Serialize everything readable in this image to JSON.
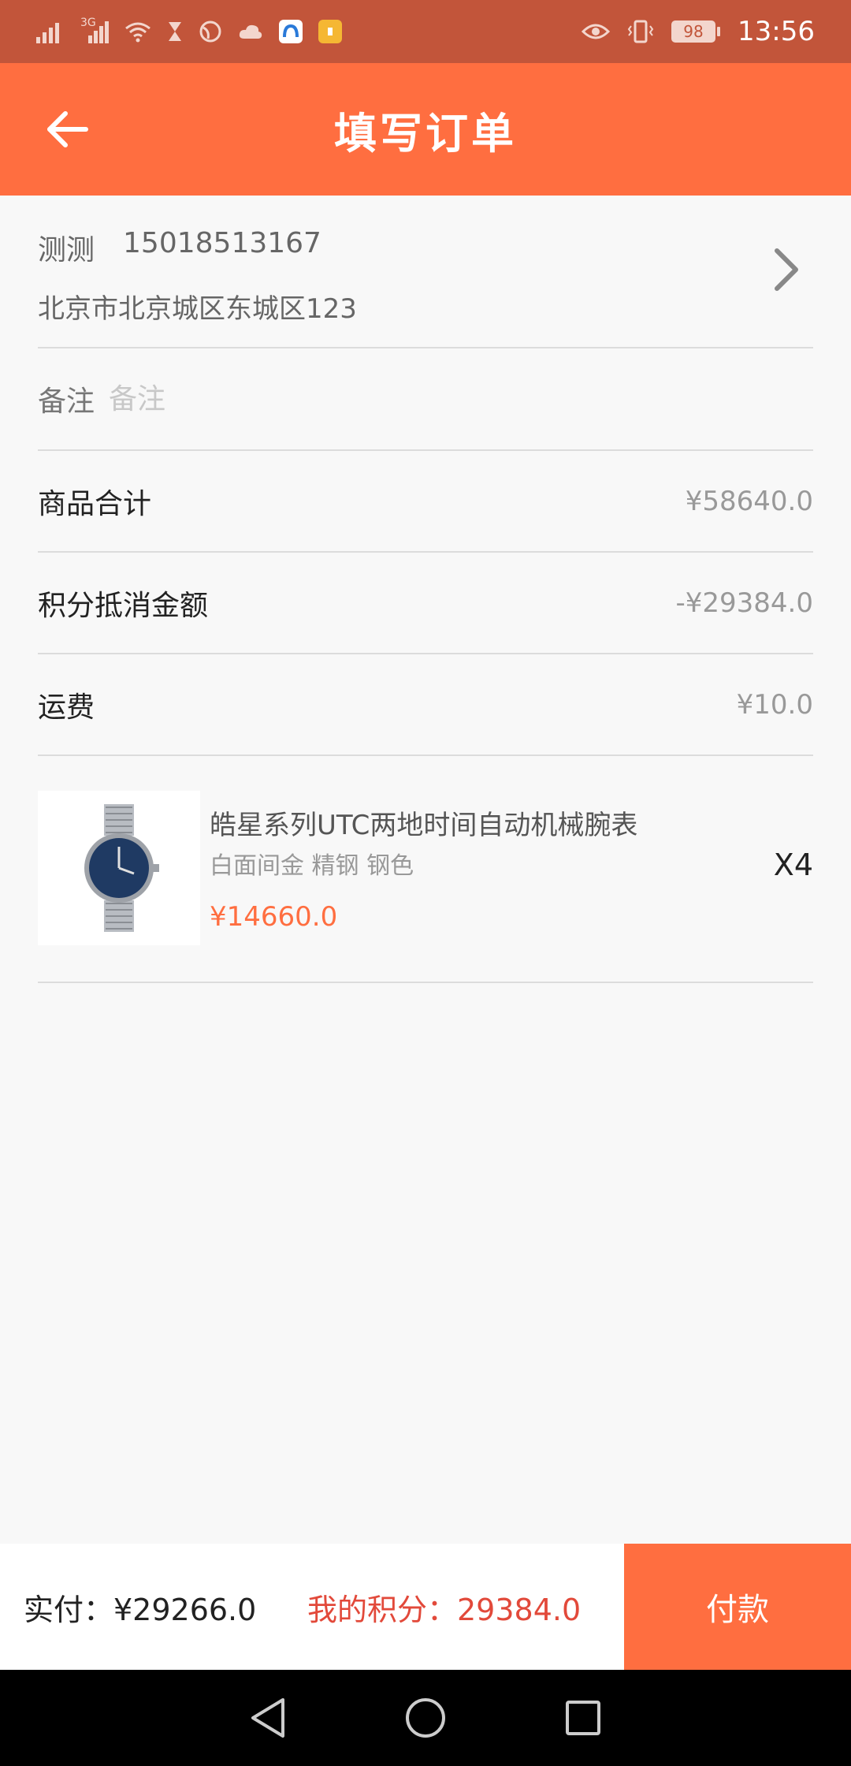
{
  "status_bar": {
    "network": "3G",
    "battery": "98",
    "time": "13:56",
    "icons": [
      "signal-icon",
      "signal-3g-icon",
      "wifi-icon",
      "hourglass-icon",
      "globe-icon",
      "cloud-icon",
      "app-icon",
      "notification-app-icon",
      "eye-icon",
      "vibrate-icon",
      "battery-icon"
    ]
  },
  "header": {
    "title": "填写订单",
    "back_icon": "arrow-left-icon"
  },
  "address": {
    "name": "测测",
    "phone": "15018513167",
    "detail": "北京市北京城区东城区123"
  },
  "remark": {
    "label": "备注",
    "placeholder": "备注",
    "value": ""
  },
  "summary": {
    "goods_total_label": "商品合计",
    "goods_total_value": "¥58640.0",
    "points_deduction_label": "积分抵消金额",
    "points_deduction_value": "-¥29384.0",
    "shipping_label": "运费",
    "shipping_value": "¥10.0"
  },
  "product": {
    "name": "皓星系列UTC两地时间自动机械腕表",
    "spec": "白面间金 精钢 钢色",
    "price": "¥14660.0",
    "quantity": "X4",
    "image_icon": "watch-icon"
  },
  "bottom_bar": {
    "actual_pay": "实付：¥29266.0",
    "my_points": "我的积分：29384.0",
    "pay_button": "付款"
  },
  "colors": {
    "header": "#ff6e40",
    "status_bar": "#c2553a",
    "accent_text": "#e2493a"
  }
}
